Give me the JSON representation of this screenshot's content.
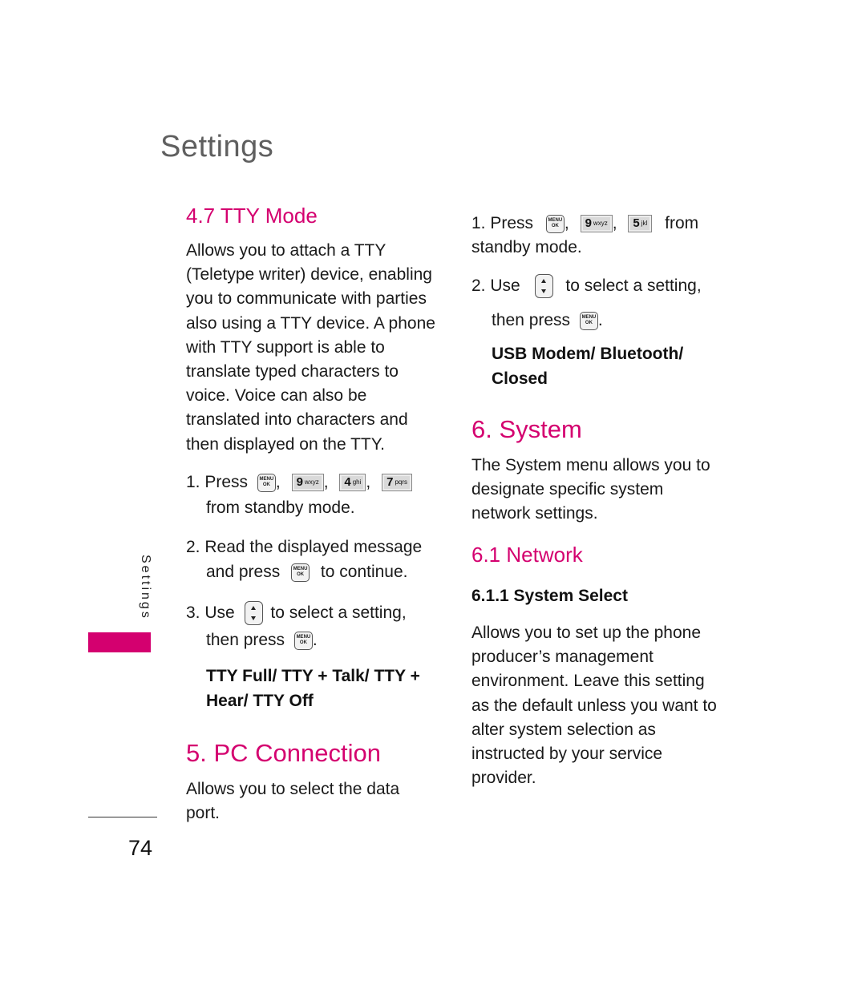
{
  "page": {
    "title": "Settings",
    "side_tab_label": "Settings",
    "page_number": "74",
    "accent_color": "#d4006f"
  },
  "left_column": {
    "tty_mode": {
      "heading": "4.7 TTY Mode",
      "description": [
        "Allows you to attach a TTY",
        "(Teletype writer) device, enabling",
        "you to communicate with parties",
        "also using a TTY device. A phone",
        "with TTY support is able to",
        "translate typed characters to",
        "voice. Voice can also be",
        "translated into characters and",
        "then displayed on the TTY."
      ],
      "step1": {
        "num": "1.",
        "press": "Press",
        "keys": [
          "MENU OK",
          "9 wxyz",
          "4 ghi",
          "7 pqrs"
        ],
        "sep": ",",
        "suffix": "from standby mode."
      },
      "step2": {
        "num": "2.",
        "line1": "Read the displayed message",
        "line2_prefix": "and press",
        "line2_suffix": "to continue."
      },
      "step3": {
        "num": "3.",
        "prefix": "Use",
        "suffix": "to select a setting,",
        "line2_prefix": "then press",
        "line2_suffix": "."
      },
      "options": [
        "TTY Full/ TTY + Talk/ TTY +",
        "Hear/ TTY Off"
      ]
    },
    "pc_connection": {
      "heading": "5. PC Connection",
      "description": [
        "Allows you to select the data",
        "port."
      ]
    }
  },
  "right_column": {
    "pc_steps": {
      "step1": {
        "num": "1.",
        "press": "Press",
        "keys": [
          "MENU OK",
          "9 wxyz",
          "5 jkl"
        ],
        "sep": ",",
        "suffix_inline": "from",
        "suffix_line2": "standby mode."
      },
      "step2": {
        "num": "2.",
        "prefix": "Use",
        "suffix": "to select a setting,",
        "line2_prefix": "then press",
        "line2_suffix": "."
      },
      "options": [
        "USB Modem/ Bluetooth/",
        "Closed"
      ]
    },
    "system": {
      "heading": "6. System",
      "description": [
        "The System menu allows you to",
        "designate specific system",
        "network settings."
      ]
    },
    "network": {
      "heading": "6.1 Network",
      "subheading": "6.1.1 System Select",
      "description": [
        "Allows you to set up the phone",
        "producer’s management",
        "environment. Leave this setting",
        "as the default unless you want to",
        "alter system selection as",
        "instructed by your service",
        "provider."
      ]
    }
  },
  "icons": {
    "menu_ok_top": "MENU",
    "menu_ok_bottom": "OK",
    "key9_num": "9",
    "key9_letters": "wxyz",
    "key4_num": "4",
    "key4_letters": "ghi",
    "key7_num": "7",
    "key7_letters": "pqrs",
    "key5_num": "5",
    "key5_letters": "jkl"
  }
}
